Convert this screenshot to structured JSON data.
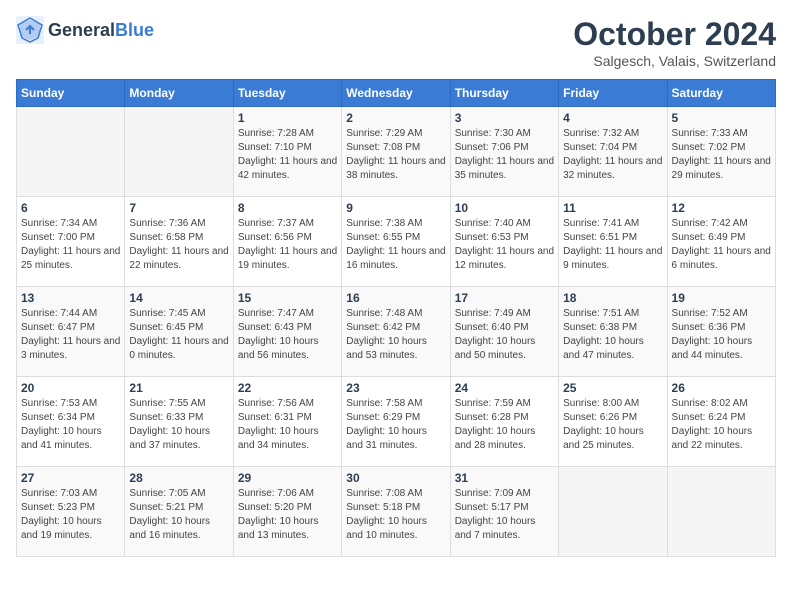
{
  "header": {
    "logo": {
      "general": "General",
      "blue": "Blue"
    },
    "title": "October 2024",
    "location": "Salgesch, Valais, Switzerland"
  },
  "weekdays": [
    "Sunday",
    "Monday",
    "Tuesday",
    "Wednesday",
    "Thursday",
    "Friday",
    "Saturday"
  ],
  "weeks": [
    [
      {
        "day": null
      },
      {
        "day": null
      },
      {
        "day": "1",
        "sunrise": "Sunrise: 7:28 AM",
        "sunset": "Sunset: 7:10 PM",
        "daylight": "Daylight: 11 hours and 42 minutes."
      },
      {
        "day": "2",
        "sunrise": "Sunrise: 7:29 AM",
        "sunset": "Sunset: 7:08 PM",
        "daylight": "Daylight: 11 hours and 38 minutes."
      },
      {
        "day": "3",
        "sunrise": "Sunrise: 7:30 AM",
        "sunset": "Sunset: 7:06 PM",
        "daylight": "Daylight: 11 hours and 35 minutes."
      },
      {
        "day": "4",
        "sunrise": "Sunrise: 7:32 AM",
        "sunset": "Sunset: 7:04 PM",
        "daylight": "Daylight: 11 hours and 32 minutes."
      },
      {
        "day": "5",
        "sunrise": "Sunrise: 7:33 AM",
        "sunset": "Sunset: 7:02 PM",
        "daylight": "Daylight: 11 hours and 29 minutes."
      }
    ],
    [
      {
        "day": "6",
        "sunrise": "Sunrise: 7:34 AM",
        "sunset": "Sunset: 7:00 PM",
        "daylight": "Daylight: 11 hours and 25 minutes."
      },
      {
        "day": "7",
        "sunrise": "Sunrise: 7:36 AM",
        "sunset": "Sunset: 6:58 PM",
        "daylight": "Daylight: 11 hours and 22 minutes."
      },
      {
        "day": "8",
        "sunrise": "Sunrise: 7:37 AM",
        "sunset": "Sunset: 6:56 PM",
        "daylight": "Daylight: 11 hours and 19 minutes."
      },
      {
        "day": "9",
        "sunrise": "Sunrise: 7:38 AM",
        "sunset": "Sunset: 6:55 PM",
        "daylight": "Daylight: 11 hours and 16 minutes."
      },
      {
        "day": "10",
        "sunrise": "Sunrise: 7:40 AM",
        "sunset": "Sunset: 6:53 PM",
        "daylight": "Daylight: 11 hours and 12 minutes."
      },
      {
        "day": "11",
        "sunrise": "Sunrise: 7:41 AM",
        "sunset": "Sunset: 6:51 PM",
        "daylight": "Daylight: 11 hours and 9 minutes."
      },
      {
        "day": "12",
        "sunrise": "Sunrise: 7:42 AM",
        "sunset": "Sunset: 6:49 PM",
        "daylight": "Daylight: 11 hours and 6 minutes."
      }
    ],
    [
      {
        "day": "13",
        "sunrise": "Sunrise: 7:44 AM",
        "sunset": "Sunset: 6:47 PM",
        "daylight": "Daylight: 11 hours and 3 minutes."
      },
      {
        "day": "14",
        "sunrise": "Sunrise: 7:45 AM",
        "sunset": "Sunset: 6:45 PM",
        "daylight": "Daylight: 11 hours and 0 minutes."
      },
      {
        "day": "15",
        "sunrise": "Sunrise: 7:47 AM",
        "sunset": "Sunset: 6:43 PM",
        "daylight": "Daylight: 10 hours and 56 minutes."
      },
      {
        "day": "16",
        "sunrise": "Sunrise: 7:48 AM",
        "sunset": "Sunset: 6:42 PM",
        "daylight": "Daylight: 10 hours and 53 minutes."
      },
      {
        "day": "17",
        "sunrise": "Sunrise: 7:49 AM",
        "sunset": "Sunset: 6:40 PM",
        "daylight": "Daylight: 10 hours and 50 minutes."
      },
      {
        "day": "18",
        "sunrise": "Sunrise: 7:51 AM",
        "sunset": "Sunset: 6:38 PM",
        "daylight": "Daylight: 10 hours and 47 minutes."
      },
      {
        "day": "19",
        "sunrise": "Sunrise: 7:52 AM",
        "sunset": "Sunset: 6:36 PM",
        "daylight": "Daylight: 10 hours and 44 minutes."
      }
    ],
    [
      {
        "day": "20",
        "sunrise": "Sunrise: 7:53 AM",
        "sunset": "Sunset: 6:34 PM",
        "daylight": "Daylight: 10 hours and 41 minutes."
      },
      {
        "day": "21",
        "sunrise": "Sunrise: 7:55 AM",
        "sunset": "Sunset: 6:33 PM",
        "daylight": "Daylight: 10 hours and 37 minutes."
      },
      {
        "day": "22",
        "sunrise": "Sunrise: 7:56 AM",
        "sunset": "Sunset: 6:31 PM",
        "daylight": "Daylight: 10 hours and 34 minutes."
      },
      {
        "day": "23",
        "sunrise": "Sunrise: 7:58 AM",
        "sunset": "Sunset: 6:29 PM",
        "daylight": "Daylight: 10 hours and 31 minutes."
      },
      {
        "day": "24",
        "sunrise": "Sunrise: 7:59 AM",
        "sunset": "Sunset: 6:28 PM",
        "daylight": "Daylight: 10 hours and 28 minutes."
      },
      {
        "day": "25",
        "sunrise": "Sunrise: 8:00 AM",
        "sunset": "Sunset: 6:26 PM",
        "daylight": "Daylight: 10 hours and 25 minutes."
      },
      {
        "day": "26",
        "sunrise": "Sunrise: 8:02 AM",
        "sunset": "Sunset: 6:24 PM",
        "daylight": "Daylight: 10 hours and 22 minutes."
      }
    ],
    [
      {
        "day": "27",
        "sunrise": "Sunrise: 7:03 AM",
        "sunset": "Sunset: 5:23 PM",
        "daylight": "Daylight: 10 hours and 19 minutes."
      },
      {
        "day": "28",
        "sunrise": "Sunrise: 7:05 AM",
        "sunset": "Sunset: 5:21 PM",
        "daylight": "Daylight: 10 hours and 16 minutes."
      },
      {
        "day": "29",
        "sunrise": "Sunrise: 7:06 AM",
        "sunset": "Sunset: 5:20 PM",
        "daylight": "Daylight: 10 hours and 13 minutes."
      },
      {
        "day": "30",
        "sunrise": "Sunrise: 7:08 AM",
        "sunset": "Sunset: 5:18 PM",
        "daylight": "Daylight: 10 hours and 10 minutes."
      },
      {
        "day": "31",
        "sunrise": "Sunrise: 7:09 AM",
        "sunset": "Sunset: 5:17 PM",
        "daylight": "Daylight: 10 hours and 7 minutes."
      },
      {
        "day": null
      },
      {
        "day": null
      }
    ]
  ]
}
